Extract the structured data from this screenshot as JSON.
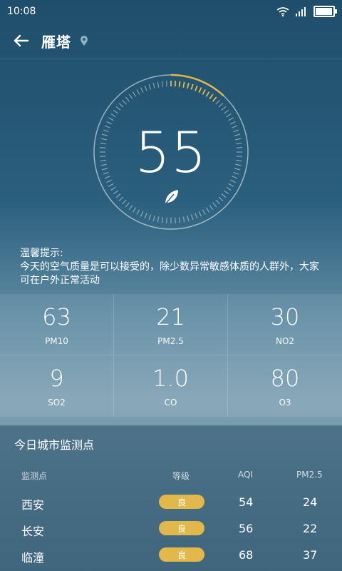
{
  "status_bar": {
    "time": "10:08"
  },
  "header": {
    "city": "雁塔"
  },
  "aqi": {
    "value": "55",
    "gauge_fraction": 0.12
  },
  "tip": {
    "title": "温馨提示:",
    "body": "今天的空气质量是可以接受的，除少数异常敏感体质的人群外，大家可在户外正常活动"
  },
  "metrics": [
    {
      "value": "63",
      "label": "PM10"
    },
    {
      "value": "21",
      "label": "PM2.5"
    },
    {
      "value": "30",
      "label": "NO2"
    },
    {
      "value": "9",
      "label": "SO2"
    },
    {
      "value": "1.0",
      "label": "CO"
    },
    {
      "value": "80",
      "label": "O3"
    }
  ],
  "stations": {
    "title": "今日城市监测点",
    "headers": {
      "station": "监测点",
      "grade": "等级",
      "aqi": "AQI",
      "pm25": "PM2.5"
    },
    "rows": [
      {
        "name": "西安",
        "grade": "良",
        "aqi": "54",
        "pm25": "24"
      },
      {
        "name": "长安",
        "grade": "良",
        "aqi": "56",
        "pm25": "22"
      },
      {
        "name": "临潼",
        "grade": "良",
        "aqi": "68",
        "pm25": "37"
      }
    ]
  },
  "colors": {
    "accent": "#e3b84a"
  },
  "icons": [
    "wifi-icon",
    "signal-icon",
    "battery-icon",
    "back-arrow-icon",
    "location-pin-icon",
    "leaf-icon"
  ]
}
